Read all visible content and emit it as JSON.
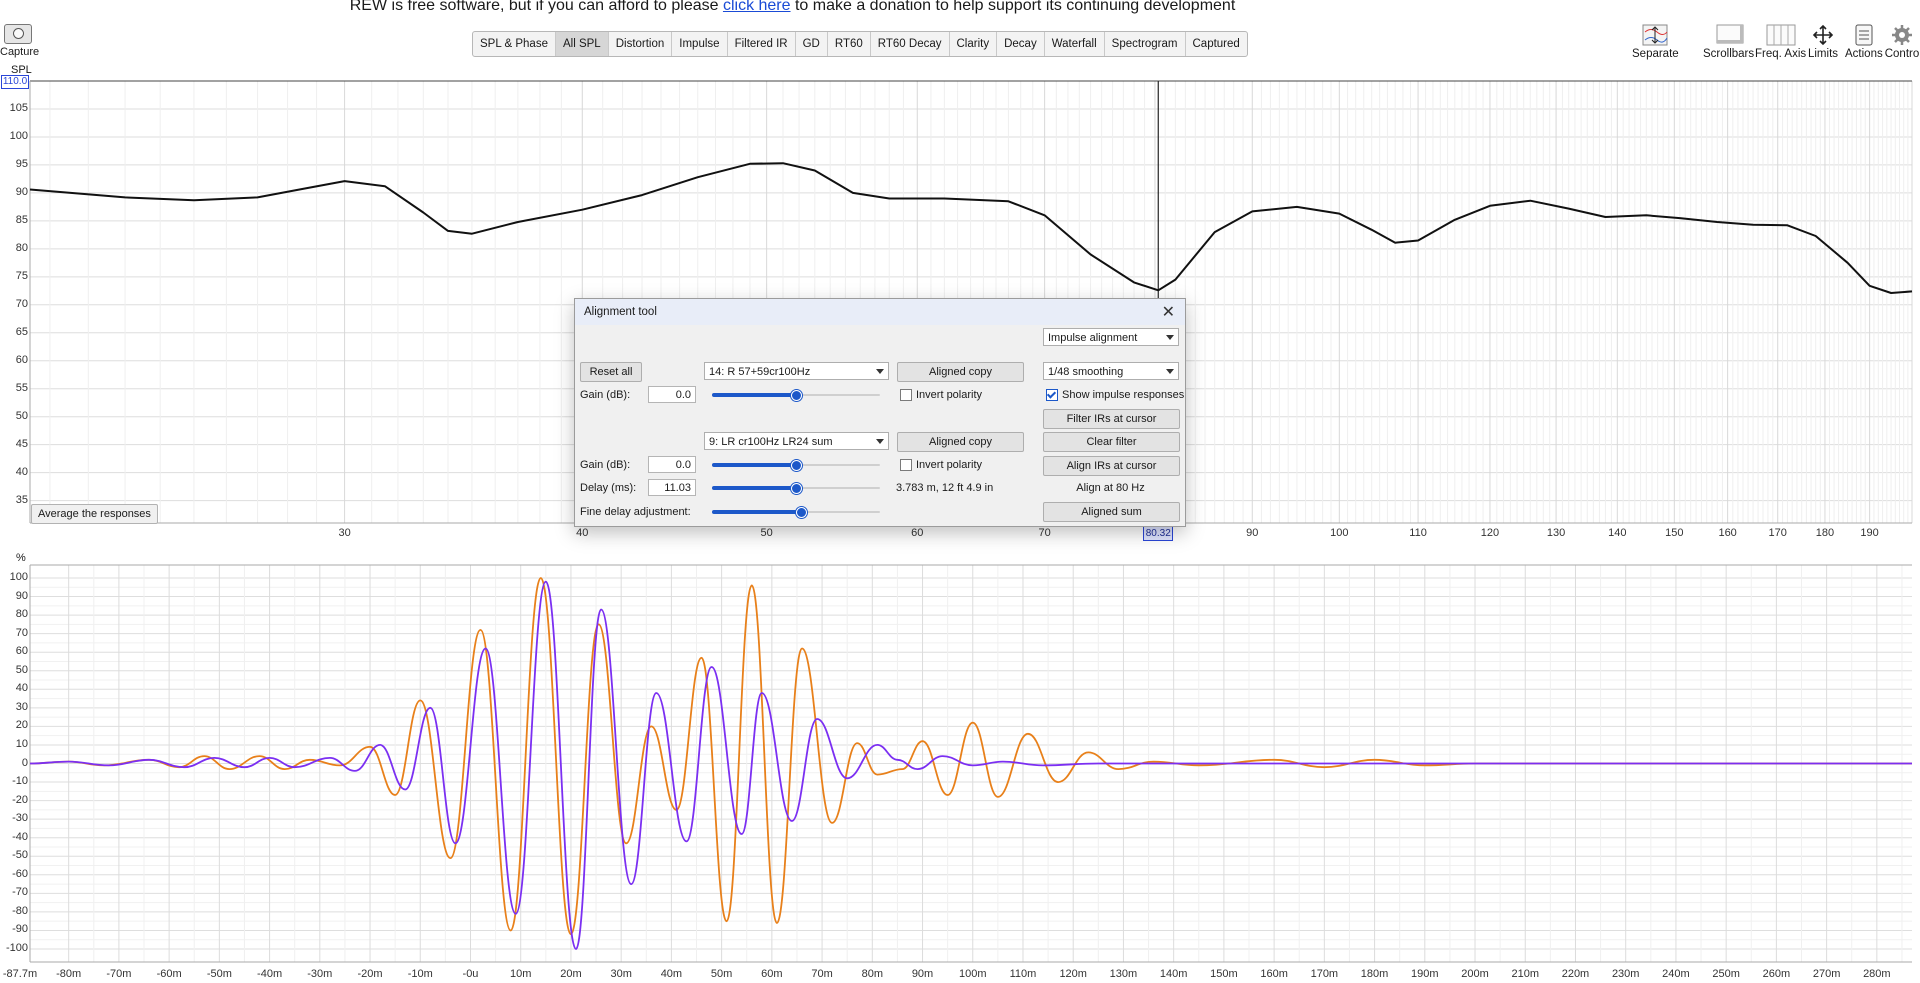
{
  "banner": {
    "prefix": "REW is free software, but if you can afford to please ",
    "link": "click here",
    "suffix": " to make a donation to help support its continuing development"
  },
  "capture": {
    "label": "Capture"
  },
  "tabs": [
    "SPL & Phase",
    "All SPL",
    "Distortion",
    "Impulse",
    "Filtered IR",
    "GD",
    "RT60",
    "RT60 Decay",
    "Clarity",
    "Decay",
    "Waterfall",
    "Spectrogram",
    "Captured"
  ],
  "active_tab": "All SPL",
  "toolbar": {
    "separate": "Separate",
    "scrollbars": "Scrollbars",
    "freq_axis": "Freq. Axis",
    "limits": "Limits",
    "actions": "Actions",
    "controls": "Contro"
  },
  "spl_chart": {
    "ylabel": "SPL",
    "ytop": "110.0",
    "yticks": [
      "105",
      "100",
      "95",
      "90",
      "85",
      "80",
      "75",
      "70",
      "65",
      "60",
      "55",
      "50",
      "45",
      "40",
      "35"
    ],
    "xticks": [
      "30",
      "40",
      "50",
      "60",
      "70",
      "90",
      "100",
      "110",
      "120",
      "130",
      "140",
      "150",
      "160",
      "170",
      "180",
      "190"
    ],
    "cursor_freq": "80.32",
    "average_button": "Average the responses"
  },
  "ir_chart": {
    "ylabel": "%",
    "yticks": [
      "100",
      "90",
      "80",
      "70",
      "60",
      "50",
      "40",
      "30",
      "20",
      "10",
      "0",
      "-10",
      "-20",
      "-30",
      "-40",
      "-50",
      "-60",
      "-70",
      "-80",
      "-90",
      "-100"
    ],
    "xticks": [
      "-87.7m",
      "-80m",
      "-70m",
      "-60m",
      "-50m",
      "-40m",
      "-30m",
      "-20m",
      "-10m",
      "-0u",
      "10m",
      "20m",
      "30m",
      "40m",
      "50m",
      "60m",
      "70m",
      "80m",
      "90m",
      "100m",
      "110m",
      "120m",
      "130m",
      "140m",
      "150m",
      "160m",
      "170m",
      "180m",
      "190m",
      "200m",
      "210m",
      "220m",
      "230m",
      "240m",
      "250m",
      "260m",
      "270m",
      "280m"
    ]
  },
  "dialog": {
    "title": "Alignment tool",
    "mode": "Impulse alignment",
    "reset_all": "Reset all",
    "measurement1": "14: R 57+59cr100Hz",
    "aligned_copy": "Aligned copy",
    "smoothing": "1/48 smoothing",
    "gain_label": "Gain (dB):",
    "gain1": "0.0",
    "gain1_slider": 0.5,
    "invert_polarity": "Invert polarity",
    "show_impulse": "Show impulse responses",
    "show_impulse_checked": true,
    "filter_irs": "Filter IRs at cursor",
    "measurement2": "9: LR cr100Hz LR24 sum",
    "clear_filter": "Clear filter",
    "gain2": "0.0",
    "gain2_slider": 0.5,
    "align_irs": "Align IRs at cursor",
    "delay_label": "Delay (ms):",
    "delay": "11.03",
    "delay_slider": 0.5,
    "distance": "3.783 m, 12 ft 4.9 in",
    "align_at": "Align at 80 Hz",
    "fine_delay_label": "Fine delay adjustment:",
    "fine_delay_slider": 0.53,
    "aligned_sum": "Aligned sum"
  },
  "colors": {
    "spl_trace": "#111111",
    "ir_orange": "#e8801a",
    "ir_purple": "#7b2ff2",
    "slider_accent": "#1c58c9"
  }
}
